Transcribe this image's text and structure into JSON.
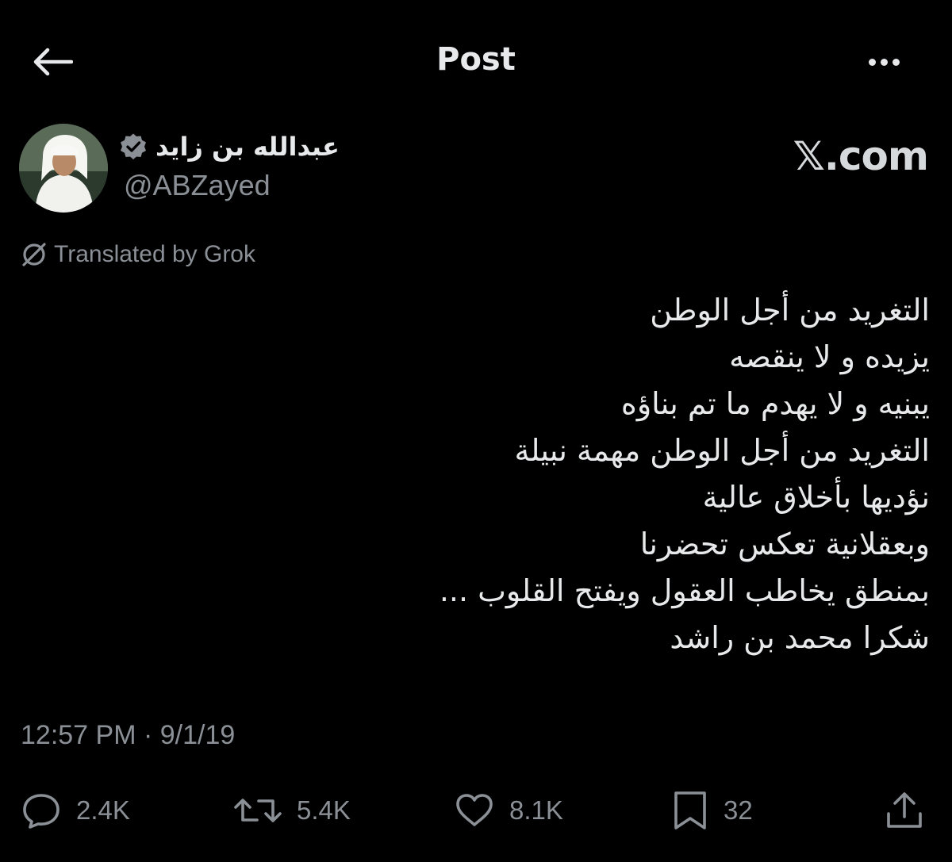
{
  "header": {
    "title": "Post",
    "back_icon": "arrow-left-icon",
    "more_icon": "more-horizontal-icon"
  },
  "brand": {
    "label": "𝕏.com"
  },
  "author": {
    "name": "عبدالله بن زايد",
    "handle": "@ABZayed",
    "verified": true,
    "verified_color": "#8b9096"
  },
  "translation": {
    "label": "Translated by Grok",
    "icon": "no-translate-icon"
  },
  "post": {
    "lines": [
      "التغريد من أجل الوطن",
      "يزيده و لا ينقصه",
      "يبنيه و لا يهدم ما تم بناؤه",
      "التغريد من أجل الوطن مهمة نبيلة",
      "نؤديها بأخلاق عالية",
      "وبعقلانية تعكس تحضرنا",
      "بمنطق يخاطب العقول ويفتح القلوب ...",
      "شكرا محمد بن راشد"
    ],
    "timestamp": "12:57 PM · 9/1/19"
  },
  "actions": {
    "replies": "2.4K",
    "reposts": "5.4K",
    "likes": "8.1K",
    "bookmarks": "32"
  },
  "colors": {
    "background": "#000000",
    "text": "#e7e9ea",
    "muted": "#8b9096"
  }
}
